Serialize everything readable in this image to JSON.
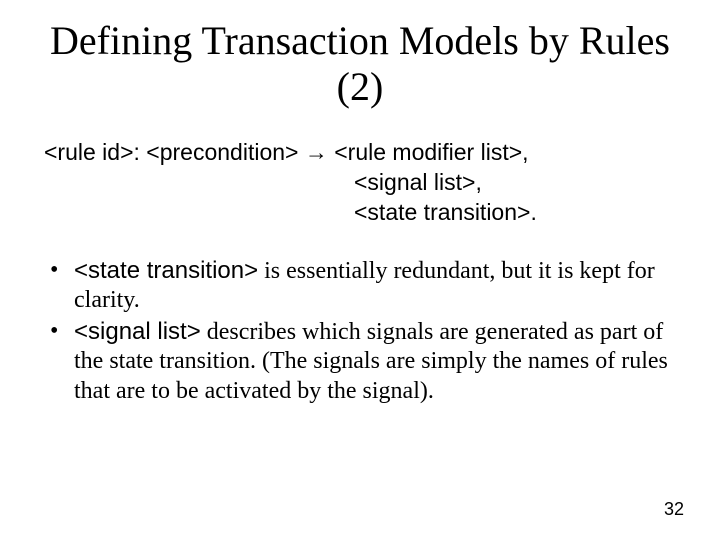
{
  "title": "Defining Transaction Models by Rules (2)",
  "grammar": {
    "line1": "<rule id>: <precondition> → <rule modifier list>,",
    "line2": "<signal list>,",
    "line3": "<state transition>."
  },
  "bullets": [
    {
      "term": "<state transition>",
      "rest": " is essentially redundant, but it is kept for clarity."
    },
    {
      "term": "<signal list>",
      "rest": " describes which signals are generated as part of the state transition. (The signals are simply the names of rules that are to be activated by the signal)."
    }
  ],
  "pagenum": "32"
}
